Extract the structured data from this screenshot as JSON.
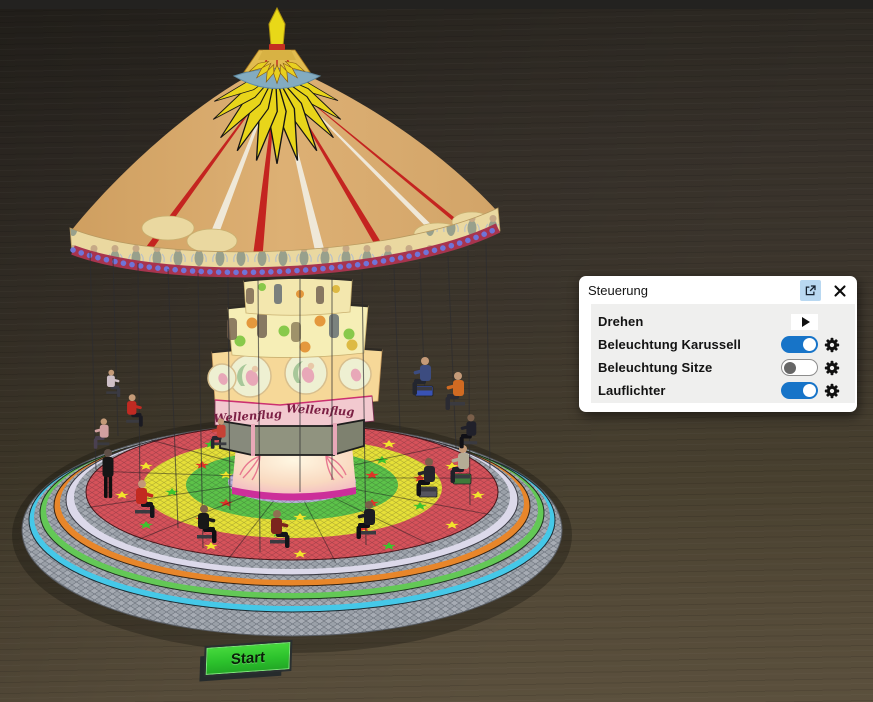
{
  "control_window": {
    "title": "Steuerung",
    "rows": [
      {
        "label": "Drehen",
        "control": "play"
      },
      {
        "label": "Beleuchtung Karussell",
        "control": "toggle",
        "state": "on"
      },
      {
        "label": "Beleuchtung Sitze",
        "control": "toggle",
        "state": "off"
      },
      {
        "label": "Lauflichter",
        "control": "toggle",
        "state": "on"
      }
    ],
    "colors": {
      "toggle_on": "#1774c8",
      "popout_bg": "#b9d8f1"
    }
  },
  "scene": {
    "ride_banner": "Wellenflug",
    "start_button_label": "Start"
  }
}
